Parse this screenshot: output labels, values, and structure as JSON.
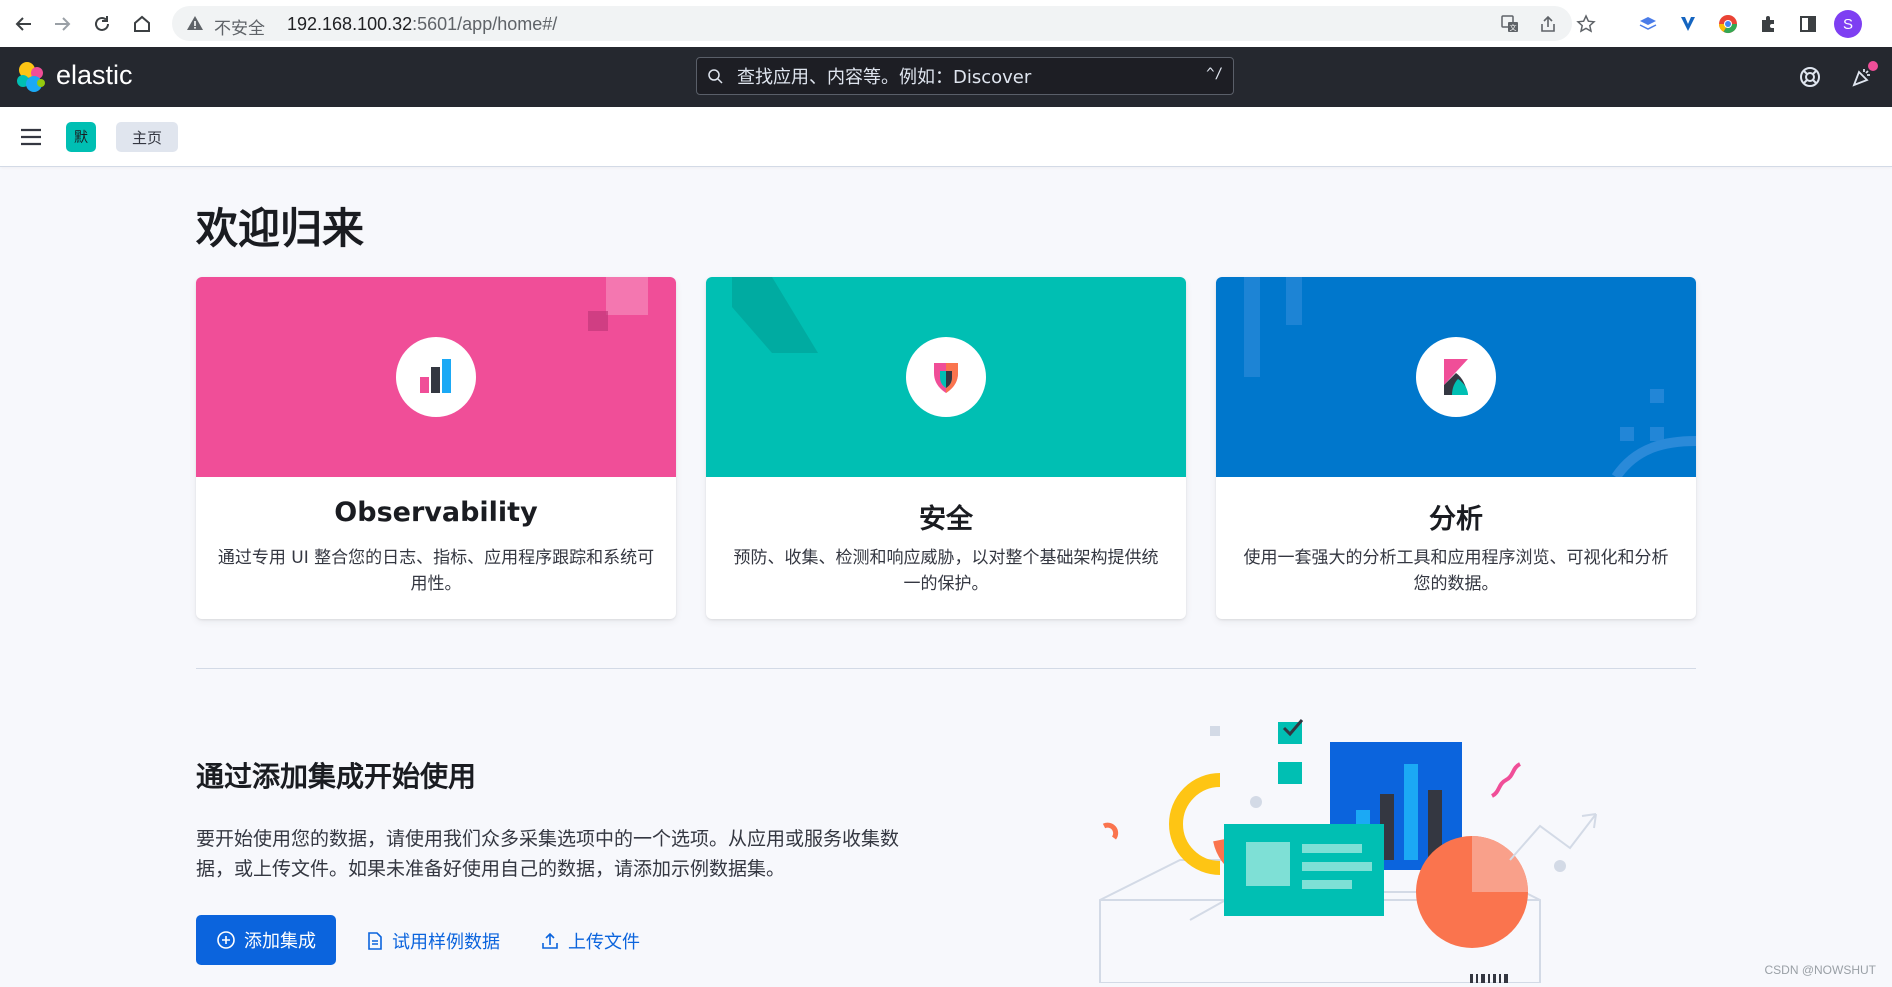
{
  "browser": {
    "insecure_label": "不安全",
    "url_host": "192.168.100.32",
    "url_rest": ":5601/app/home#/",
    "profile_initial": "S"
  },
  "header": {
    "brand": "elastic",
    "search_placeholder": "查找应用、内容等。例如：Discover",
    "search_shortcut": "^/"
  },
  "subheader": {
    "space_initial": "默",
    "breadcrumb": "主页"
  },
  "main": {
    "title": "欢迎归来",
    "cards": [
      {
        "title": "Observability",
        "description": "通过专用 UI 整合您的日志、指标、应用程序跟踪和系统可用性。",
        "color": "#f04e98"
      },
      {
        "title": "安全",
        "description": "预防、收集、检测和响应威胁，以对整个基础架构提供统一的保护。",
        "color": "#00bfb3"
      },
      {
        "title": "分析",
        "description": "使用一套强大的分析工具和应用程序浏览、可视化和分析您的数据。",
        "color": "#0077cc"
      }
    ],
    "integrations": {
      "title": "通过添加集成开始使用",
      "description": "要开始使用您的数据，请使用我们众多采集选项中的一个选项。从应用或服务收集数据，或上传文件。如果未准备好使用自己的数据，请添加示例数据集。",
      "add_button": "添加集成",
      "sample_link": "试用样例数据",
      "upload_link": "上传文件"
    }
  },
  "watermark": "CSDN @NOWSHUT"
}
